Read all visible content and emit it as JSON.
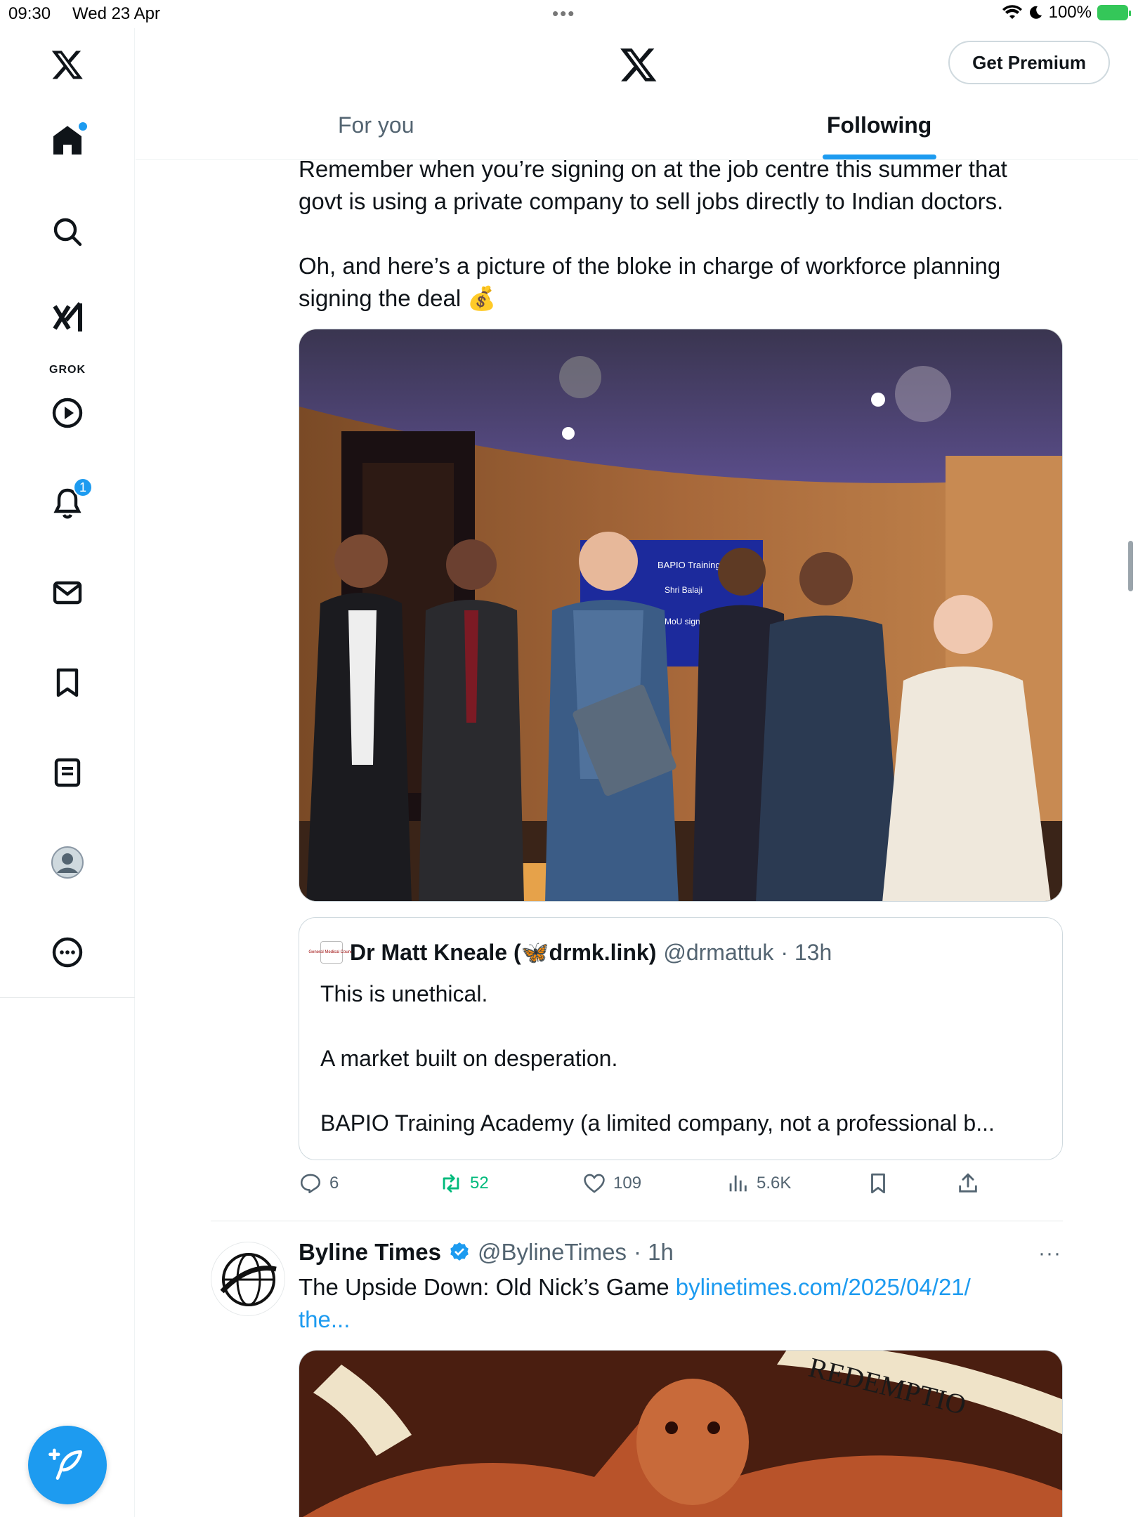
{
  "status_bar": {
    "time": "09:30",
    "date": "Wed 23 Apr",
    "battery": "100%"
  },
  "sidebar": {
    "items": [
      {
        "name": "home",
        "icon": "home-icon"
      },
      {
        "name": "explore",
        "icon": "search-icon"
      },
      {
        "name": "grok",
        "icon": "grok-icon",
        "label": "GROK"
      },
      {
        "name": "videos",
        "icon": "play-icon"
      },
      {
        "name": "notifications",
        "icon": "bell-icon",
        "badge": "1"
      },
      {
        "name": "messages",
        "icon": "mail-icon"
      },
      {
        "name": "bookmarks",
        "icon": "bookmark-icon"
      },
      {
        "name": "lists",
        "icon": "list-icon"
      },
      {
        "name": "profile",
        "icon": "avatar-icon"
      },
      {
        "name": "more",
        "icon": "more-icon"
      }
    ]
  },
  "header": {
    "premium_label": "Get Premium",
    "tabs": [
      {
        "label": "For you"
      },
      {
        "label": "Following"
      }
    ]
  },
  "tweet1": {
    "text_line1": "Remember when you’re signing on at the job centre this summer that",
    "text_line2": "govt is using a private company to sell jobs directly to Indian doctors.",
    "text_line3": "Oh, and here’s a picture of the bloke in charge of workforce planning",
    "text_line4": "signing the deal 💰",
    "photo_screen_text": "BAPIO Training & Shri Balaji Neuroscience MoU signing",
    "quote": {
      "name": "Dr Matt Kneale (🦋drmk.link)",
      "handle": "@drmattuk",
      "time": "· 13h",
      "avatar_text": "General Medical Council",
      "line1": "This is unethical.",
      "line2": "A market built on desperation.",
      "line3": "BAPIO Training Academy (a limited company, not a professional b..."
    },
    "actions": {
      "replies": "6",
      "reposts": "52",
      "likes": "109",
      "views": "5.6K"
    }
  },
  "tweet2": {
    "name": "Byline Times",
    "handle": "@BylineTimes",
    "time": "· 1h",
    "text": "The Upside Down: Old Nick’s Game ",
    "link": "bylinetimes.com/2025/04/21/",
    "link2": "the...",
    "more": "···",
    "image_text": "REDEMPTIO"
  },
  "colors": {
    "accent": "#1d9bf0",
    "repost": "#00ba7c",
    "muted": "#536471"
  }
}
